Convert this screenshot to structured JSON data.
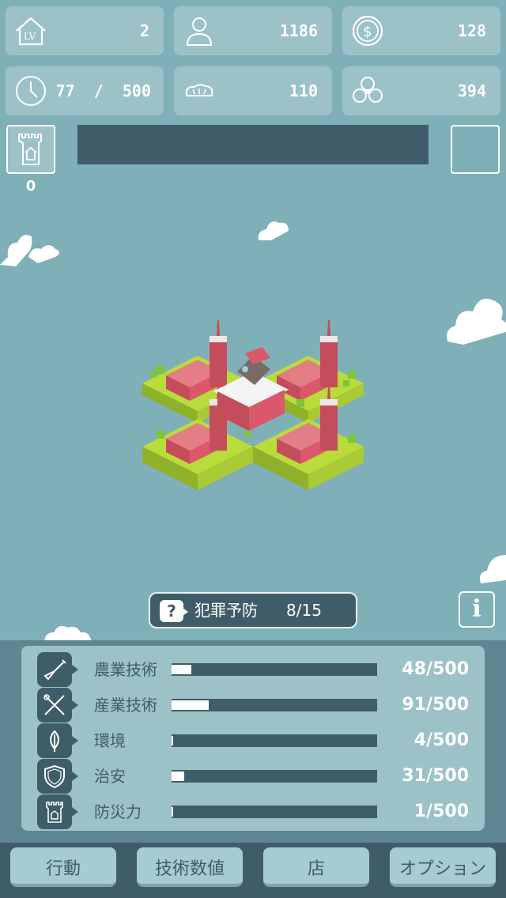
{
  "stats": {
    "level": "2",
    "population": "1186",
    "money": "128",
    "time": "77  /  500",
    "food": "110",
    "pollution": "394"
  },
  "tower_count": "0",
  "mission": {
    "icon": "?",
    "name": "犯罪予防",
    "progress": "8/15"
  },
  "info_label": "i",
  "tech": [
    {
      "label": "農業技術",
      "value": "48/500",
      "fraction": 0.096,
      "icon": "shovel-icon"
    },
    {
      "label": "産業技術",
      "value": "91/500",
      "fraction": 0.182,
      "icon": "tools-icon"
    },
    {
      "label": "環境",
      "value": "4/500",
      "fraction": 0.008,
      "icon": "leaf-icon"
    },
    {
      "label": "治安",
      "value": "31/500",
      "fraction": 0.062,
      "icon": "shield-icon"
    },
    {
      "label": "防災力",
      "value": "1/500",
      "fraction": 0.002,
      "icon": "tower-icon"
    }
  ],
  "nav": {
    "action": "行動",
    "tech_values": "技術数値",
    "shop": "店",
    "options": "オプション"
  },
  "colors": {
    "background": "#7fb0b8",
    "card": "#9cc2c8",
    "dark": "#3f5d68",
    "building": "#d9596a",
    "grass": "#b6d93a"
  }
}
